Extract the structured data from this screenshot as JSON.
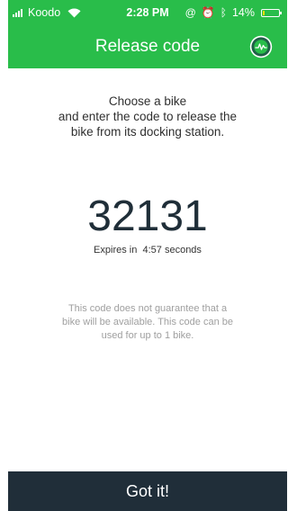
{
  "colors": {
    "header_green": "#29bd4a",
    "button_navy": "#202e39",
    "code_navy": "#1f2e38",
    "battery_yellow": "#ffe000"
  },
  "status_bar": {
    "carrier": "Koodo",
    "time": "2:28 PM",
    "battery_percent": "14%",
    "battery_level": 0.14,
    "icons": [
      "signal-icon",
      "wifi-icon",
      "at-icon",
      "alarm-icon",
      "bluetooth-icon",
      "battery-icon"
    ]
  },
  "header": {
    "title": "Release code",
    "logo_icon": "bike-share-logo-icon"
  },
  "instructions": {
    "line1": "Choose a bike",
    "line2": "and enter the code to release the",
    "line3": "bike from its docking station."
  },
  "code": {
    "value": "32131",
    "expires_label": "Expires in",
    "expires_time": "4:57",
    "expires_unit": "seconds"
  },
  "disclaimer": {
    "line1": "This code does not guarantee that a",
    "line2": "bike will be available. This code can be",
    "line3": "used for up to 1 bike."
  },
  "footer": {
    "button_label": "Got it!"
  }
}
